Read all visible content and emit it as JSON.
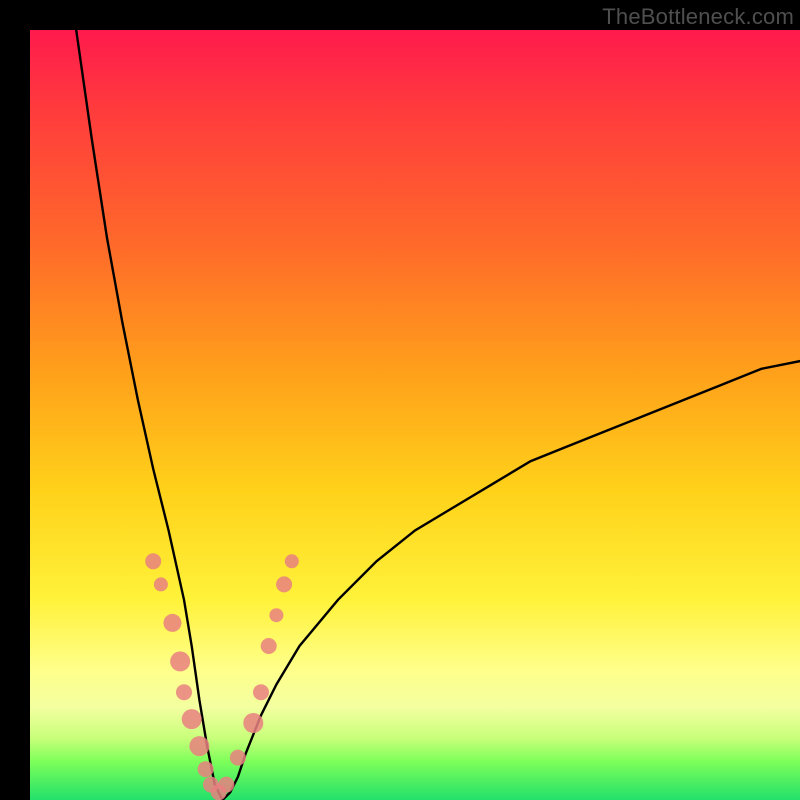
{
  "watermark": "TheBottleneck.com",
  "colors": {
    "curve": "#000000",
    "marker_fill": "#e98080",
    "marker_stroke": "#d86a6a",
    "gradient_top": "#ff1a4d",
    "gradient_bottom": "#22e06a",
    "frame_border": "#000000"
  },
  "chart_data": {
    "type": "line",
    "title": "",
    "xlabel": "",
    "ylabel": "",
    "xlim": [
      0,
      100
    ],
    "ylim": [
      0,
      100
    ],
    "grid": false,
    "legend": false,
    "notes": "V-shaped bottleneck curve on a vertical rainbow gradient. No axis tick labels are present; y values are percentage of plot height from bottom. Vertex near x≈24, y≈0. Left branch reaches y≈100 at x≈6; right branch rises more slowly to y≈57 at x=100.",
    "series": [
      {
        "name": "bottleneck-curve",
        "x": [
          6,
          8,
          10,
          12,
          14,
          16,
          18,
          20,
          21,
          22,
          23,
          24,
          25,
          26,
          27,
          28,
          30,
          32,
          35,
          40,
          45,
          50,
          55,
          60,
          65,
          70,
          75,
          80,
          85,
          90,
          95,
          100
        ],
        "y": [
          100,
          86,
          73,
          62,
          52,
          43,
          35,
          26,
          20,
          13,
          7,
          2,
          0,
          1,
          3,
          6,
          11,
          15,
          20,
          26,
          31,
          35,
          38,
          41,
          44,
          46,
          48,
          50,
          52,
          54,
          56,
          57
        ]
      }
    ],
    "markers": {
      "name": "highlight-dots",
      "x": [
        16.0,
        17.0,
        18.5,
        19.5,
        20.0,
        21.0,
        22.0,
        22.8,
        23.5,
        24.5,
        25.5,
        27.0,
        29.0,
        30.0,
        31.0,
        32.0,
        33.0,
        34.0
      ],
      "y": [
        31.0,
        28.0,
        23.0,
        18.0,
        14.0,
        10.5,
        7.0,
        4.0,
        2.0,
        1.0,
        2.0,
        5.5,
        10.0,
        14.0,
        20.0,
        24.0,
        28.0,
        31.0
      ],
      "r": [
        8,
        7,
        9,
        10,
        8,
        10,
        10,
        8,
        8,
        8,
        8,
        8,
        10,
        8,
        8,
        7,
        8,
        7
      ]
    }
  }
}
